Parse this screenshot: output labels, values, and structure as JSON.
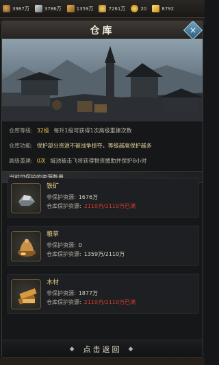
{
  "topbar": {
    "food": "3987万",
    "iron": "3786万",
    "wood": "1359万",
    "coin": "7261万",
    "plus_value": "20",
    "gold": "8792"
  },
  "dialog": {
    "title": "仓库",
    "close_icon": "×"
  },
  "info": {
    "level_label": "仓库等级:",
    "level_value": "32级",
    "level_desc": "每升1级可获得1次高级重建次数",
    "func_label": "仓库功能:",
    "func_desc": "保护部分资源不被战争掠夺，等级越高保护越多",
    "rebuild_label": "高级重建:",
    "rebuild_value": "0次",
    "rebuild_desc": "城池被击飞将获得物资援助并保护8小时"
  },
  "section": {
    "title": "当前可保护的资源数量"
  },
  "cards": [
    {
      "name": "铁矿",
      "row1_label": "非保护资源:",
      "row1_value": "1676万",
      "row2_label": "仓库保护资源:",
      "row2_value": "2110万/2110万已满"
    },
    {
      "name": "粮草",
      "row1_label": "非保护资源:",
      "row1_value": "0",
      "row2_label": "仓库保护资源:",
      "row2_value": "1359万/2110万"
    },
    {
      "name": "木材",
      "row1_label": "非保护资源:",
      "row1_value": "1877万",
      "row2_label": "仓库保护资源:",
      "row2_value": "2110万/2110万已满"
    }
  ],
  "footer": {
    "return_label": "点击返回",
    "left_arrow": "◆",
    "right_arrow": "◆"
  },
  "colors": {
    "highlight": "#e9c44a",
    "full_red": "#d33b2f"
  }
}
